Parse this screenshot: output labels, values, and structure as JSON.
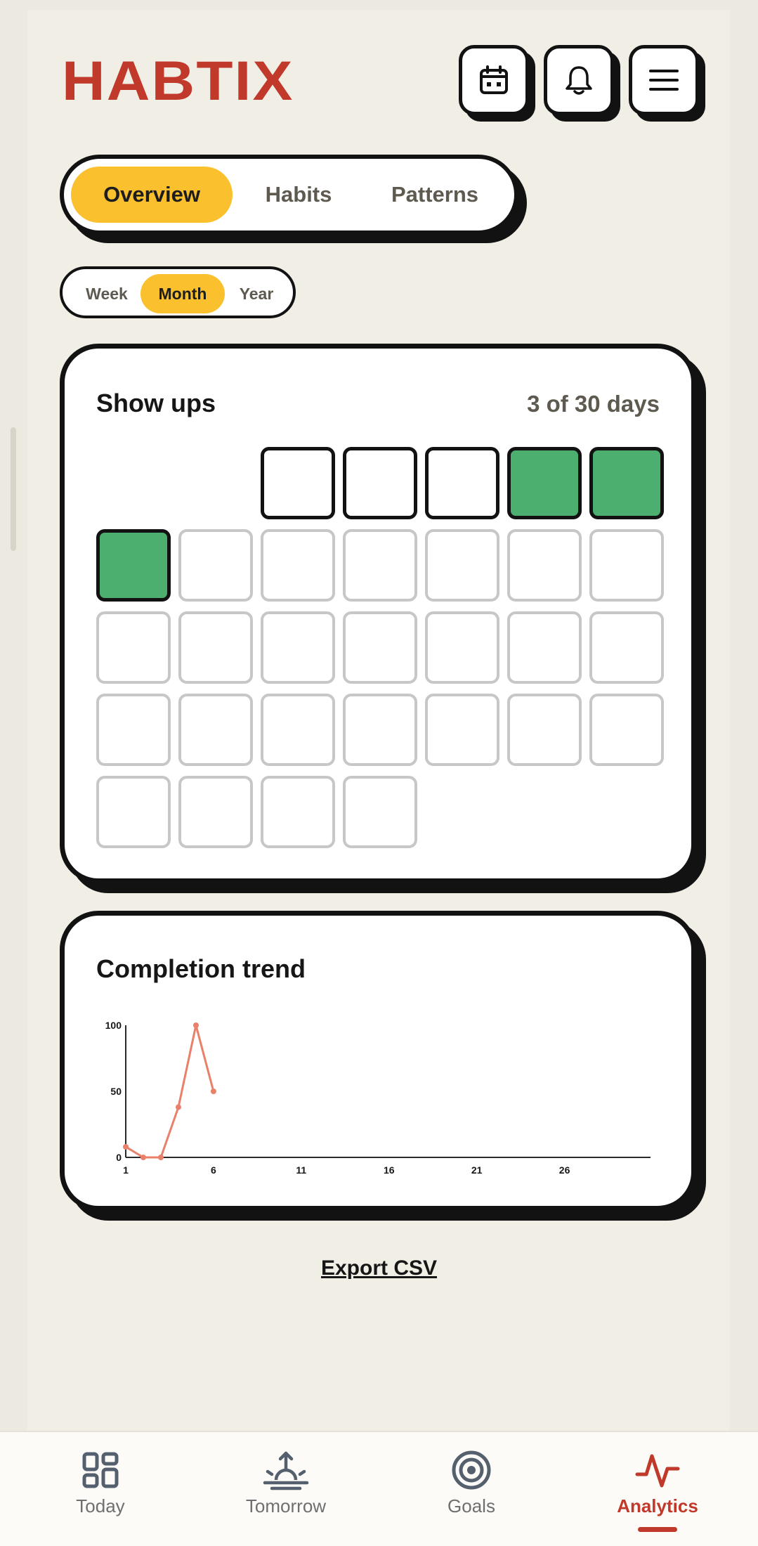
{
  "app": {
    "logo": "HABTIX"
  },
  "header": {
    "buttons": [
      {
        "name": "calendar-button",
        "icon": "calendar-icon"
      },
      {
        "name": "notifications-button",
        "icon": "bell-icon"
      },
      {
        "name": "menu-button",
        "icon": "hamburger-menu-icon"
      }
    ]
  },
  "tabs": [
    {
      "label": "Overview",
      "active": true
    },
    {
      "label": "Habits",
      "active": false
    },
    {
      "label": "Patterns",
      "active": false
    }
  ],
  "range": [
    {
      "label": "Week",
      "active": false
    },
    {
      "label": "Month",
      "active": true
    },
    {
      "label": "Year",
      "active": false
    }
  ],
  "show_ups": {
    "title": "Show ups",
    "summary": "3 of 30 days",
    "leading_blank_cells": 2,
    "days": [
      "past",
      "past",
      "past",
      "done",
      "done",
      "done",
      "future",
      "future",
      "future",
      "future",
      "future",
      "future",
      "future",
      "future",
      "future",
      "future",
      "future",
      "future",
      "future",
      "future",
      "future",
      "future",
      "future",
      "future",
      "future",
      "future",
      "future",
      "future",
      "future",
      "future"
    ]
  },
  "trend": {
    "title": "Completion trend"
  },
  "chart_data": {
    "type": "line",
    "title": "Completion trend",
    "xlabel": "",
    "ylabel": "",
    "xlim": [
      1,
      30
    ],
    "ylim": [
      0,
      100
    ],
    "x_ticks": [
      1,
      6,
      11,
      16,
      21,
      26
    ],
    "y_ticks": [
      0,
      50,
      100
    ],
    "x": [
      1,
      2,
      3,
      4,
      5,
      6
    ],
    "values": [
      8,
      0,
      0,
      38,
      100,
      50
    ],
    "color": "#e8806a",
    "grid": false
  },
  "export": {
    "label": "Export CSV"
  },
  "nav": [
    {
      "label": "Today",
      "icon": "grid-icon",
      "active": false
    },
    {
      "label": "Tomorrow",
      "icon": "sunrise-icon",
      "active": false
    },
    {
      "label": "Goals",
      "icon": "target-icon",
      "active": false
    },
    {
      "label": "Analytics",
      "icon": "activity-icon",
      "active": true
    }
  ],
  "colors": {
    "brand": "#c0392b",
    "accent": "#fbc02d",
    "done": "#4caf6f",
    "background": "#f1eee6",
    "outline": "#121212"
  }
}
